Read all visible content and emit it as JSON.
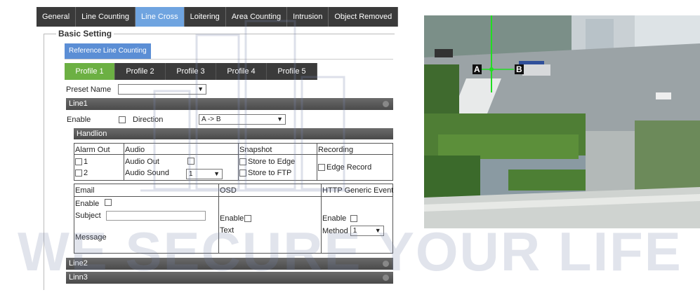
{
  "tabs": [
    "General",
    "Line Counting",
    "Line Cross",
    "Loitering",
    "Area Counting",
    "Intrusion",
    "Object Removed"
  ],
  "active_tab": "Line Cross",
  "basic_setting_label": "Basic Setting",
  "subtab_label": "Reference Line Counting",
  "profiles": [
    "Profile 1",
    "Profile 2",
    "Profile 3",
    "Profile 4",
    "Profile 5"
  ],
  "active_profile": "Profile 1",
  "preset_name_label": "Preset Name",
  "preset_value": "",
  "line1": {
    "title": "Line1",
    "enable_label": "Enable",
    "direction_label": "Direction",
    "direction_value": "A -> B",
    "handling_label": "Handlion",
    "alarm_out": {
      "header": "Alarm Out",
      "options": [
        "1",
        "2"
      ]
    },
    "audio": {
      "header": "Audio",
      "audio_out_label": "Audio Out",
      "audio_sound_label": "Audio Sound",
      "audio_sound_value": "1"
    },
    "snapshot": {
      "header": "Snapshot",
      "store_edge": "Store to Edge",
      "store_ftp": "Store to FTP"
    },
    "recording": {
      "header": "Recording",
      "edge_record": "Edge Record"
    },
    "email": {
      "header": "Email",
      "enable_label": "Enable",
      "subject_label": "Subject",
      "message_label": "Message"
    },
    "osd": {
      "header": "OSD",
      "enable_label": "Enable",
      "text_label": "Text"
    },
    "http": {
      "header": "HTTP Generic Event",
      "enable_label": "Enable",
      "method_label": "Method",
      "method_value": "1"
    }
  },
  "line2_title": "Line2",
  "line3_title": "Linn3",
  "camera": {
    "marker_a": "A",
    "marker_b": "B",
    "line_color": "#22dd22"
  },
  "watermark": "WE SECURE YOUR LIFE",
  "colors": {
    "tab_bg": "#3a3a3a",
    "tab_active": "#6fa4e0",
    "profile_active": "#6cb043",
    "band": "#555555"
  }
}
